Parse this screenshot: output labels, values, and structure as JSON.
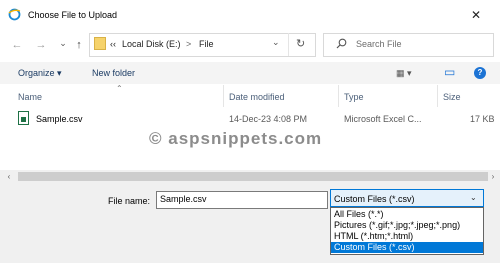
{
  "window": {
    "title": "Choose File to Upload",
    "close_glyph": "✕"
  },
  "nav": {
    "back_glyph": "←",
    "forward_glyph": "→",
    "recent_glyph": "⌄",
    "up_glyph": "↑",
    "breadcrumb_chevrons": "‹‹",
    "breadcrumb": [
      "Local Disk (E:)",
      "File"
    ],
    "separator_glyph": ">",
    "history_glyph": "⌄",
    "refresh_glyph": "↻",
    "search_placeholder": "Search File"
  },
  "toolbar": {
    "organize_label": "Organize ▾",
    "new_folder_label": "New folder",
    "view_glyph": "▦ ▾",
    "preview_glyph": "▭",
    "help_glyph": "?"
  },
  "columns": [
    "Name",
    "Date modified",
    "Type",
    "Size"
  ],
  "sort_glyph": "⌃",
  "files": [
    {
      "name": "Sample.csv",
      "date": "14-Dec-23 4:08 PM",
      "type": "Microsoft Excel C...",
      "size": "17 KB"
    }
  ],
  "watermark": "© aspsnippets.com",
  "scroll": {
    "left_glyph": "‹",
    "right_glyph": "›"
  },
  "bottom": {
    "file_name_label": "File name:",
    "file_name_value": "Sample.csv",
    "filter_selected": "Custom Files (*.csv)",
    "filter_arrow": "⌄",
    "filter_options": [
      "All Files (*.*)",
      "Pictures (*.gif;*.jpg;*.jpeg;*.png)",
      "HTML (*.htm;*.html)",
      "Custom Files (*.csv)"
    ]
  },
  "colors": {
    "accent": "#0078d7",
    "link": "#1b3b63"
  }
}
